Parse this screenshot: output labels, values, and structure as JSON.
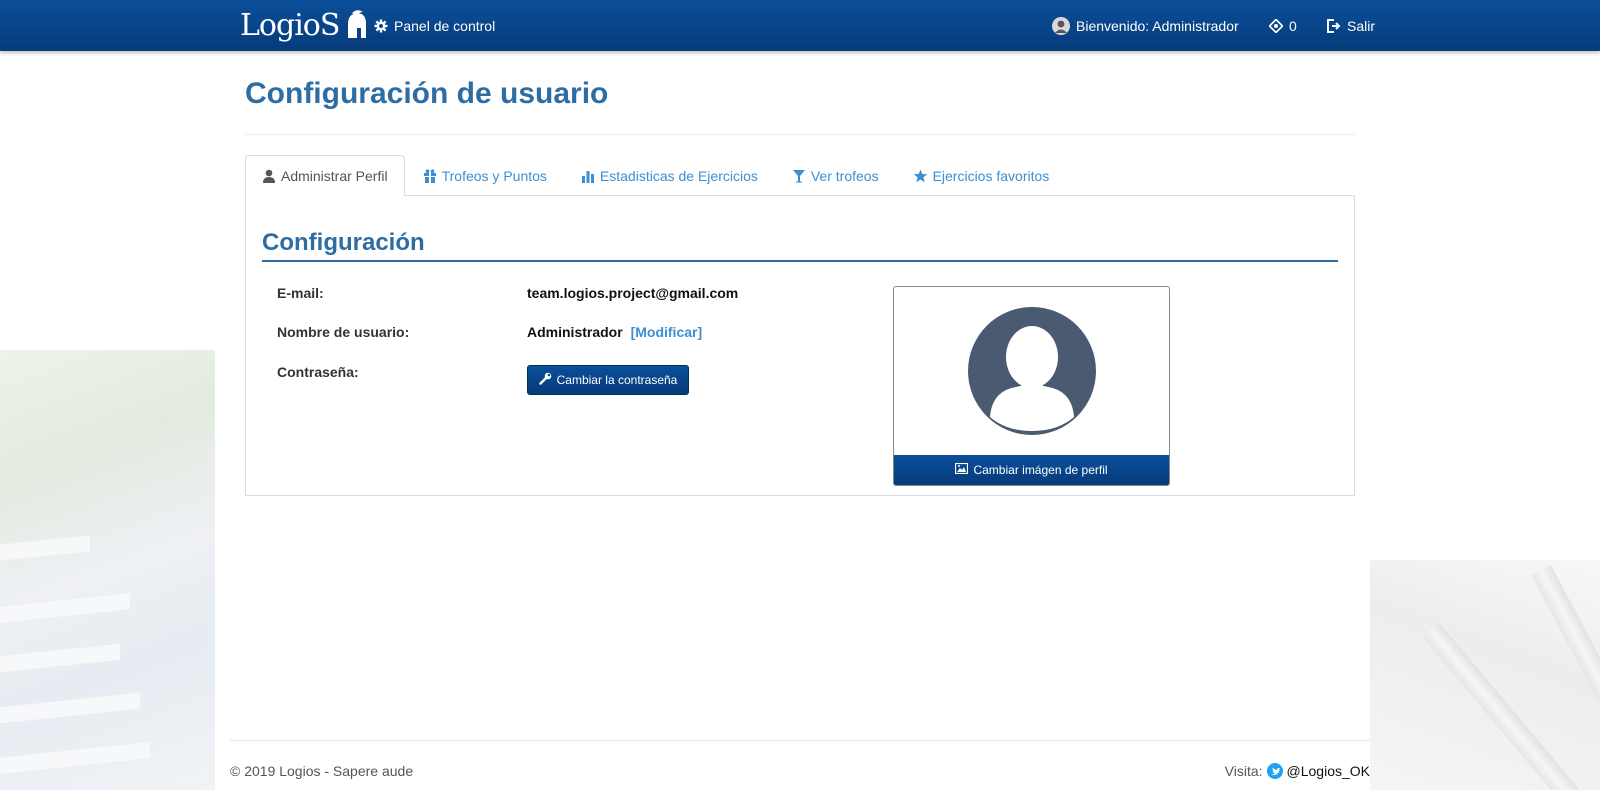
{
  "navbar": {
    "brand": "LogioS",
    "panel_label": "Panel de control",
    "welcome_label": "Bienvenido: Administrador",
    "points_value": "0",
    "logout_label": "Salir"
  },
  "page": {
    "title": "Configuración de usuario"
  },
  "tabs": [
    {
      "label": "Administrar Perfil",
      "icon": "user-icon",
      "active": true
    },
    {
      "label": "Trofeos y Puntos",
      "icon": "gift-icon",
      "active": false
    },
    {
      "label": "Estadisticas de Ejercicios",
      "icon": "bar-chart-icon",
      "active": false
    },
    {
      "label": "Ver trofeos",
      "icon": "trophy-icon",
      "active": false
    },
    {
      "label": "Ejercicios favoritos",
      "icon": "star-icon",
      "active": false
    }
  ],
  "config": {
    "section_title": "Configuración",
    "email_label": "E-mail:",
    "email_value": "team.logios.project@gmail.com",
    "username_label": "Nombre de usuario:",
    "username_value": "Administrador",
    "modify_link": "[Modificar]",
    "password_label": "Contraseña:",
    "change_password_button": "Cambiar la contraseña",
    "change_image_button": "Cambiar imágen de perfil"
  },
  "footer": {
    "copyright": "© 2019 Logios - Sapere aude",
    "visit_label": "Visita:",
    "twitter_handle": "@Logios_OK"
  },
  "colors": {
    "navbar": "#0b4f9a",
    "accent": "#2e6da4",
    "link": "#3d8fd1",
    "avatar": "#4a5a70"
  }
}
